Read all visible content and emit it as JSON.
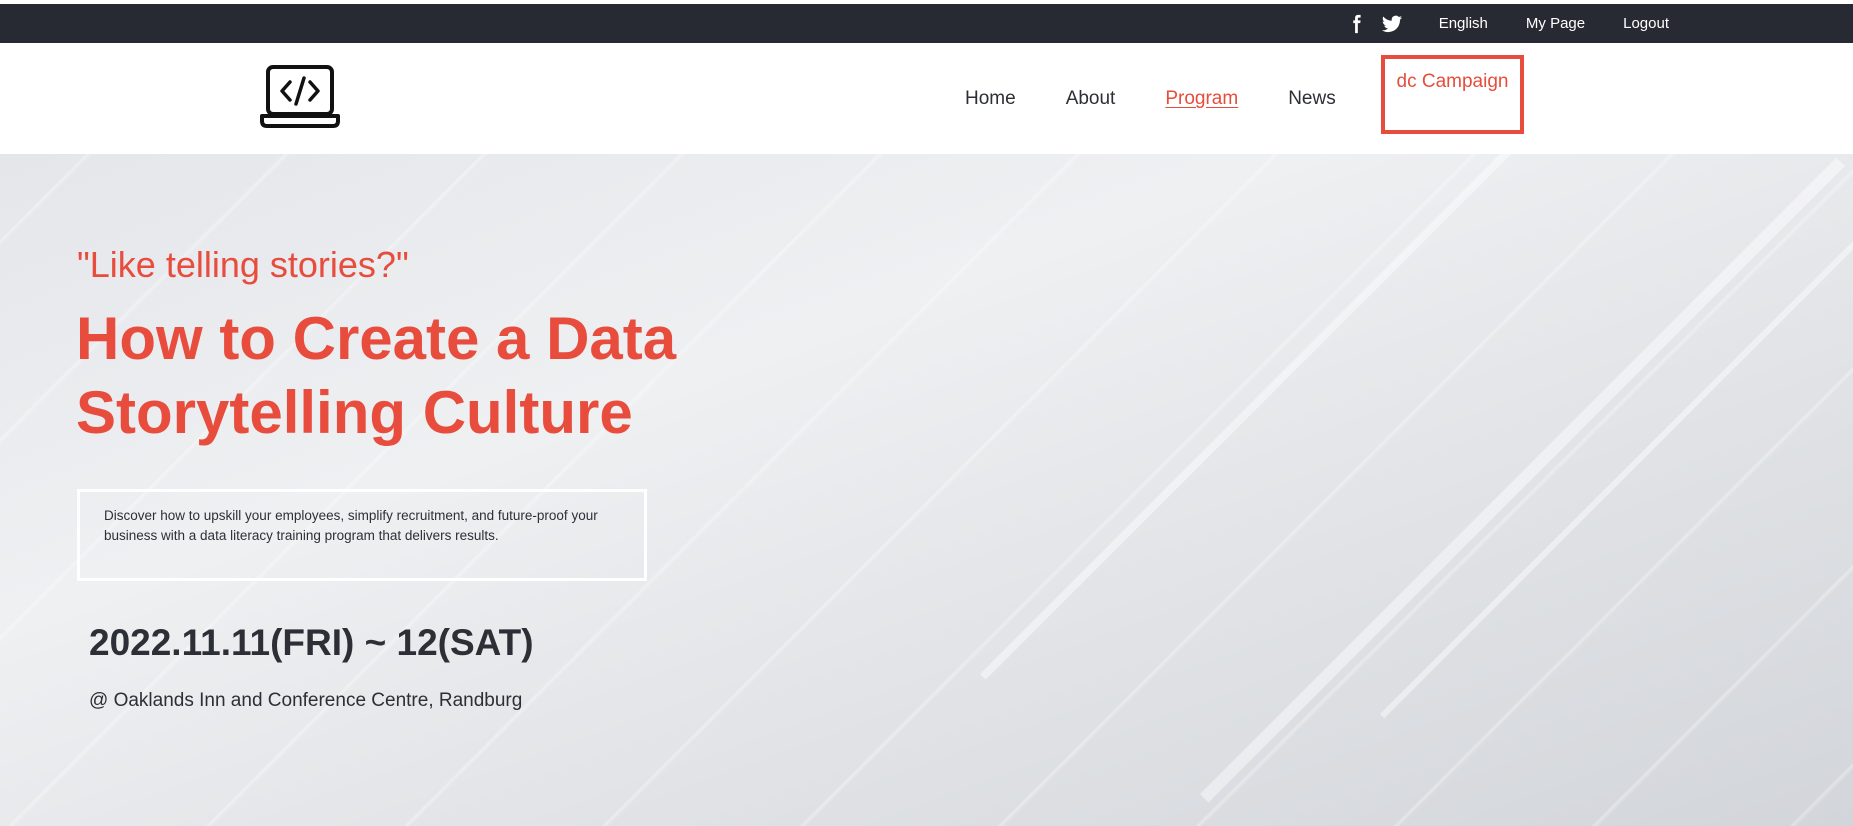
{
  "topbar": {
    "social": [
      "facebook-icon",
      "twitter-icon"
    ],
    "language": "English",
    "my_page": "My Page",
    "logout": "Logout"
  },
  "navbar": {
    "logo_icon": "laptop-code-icon",
    "items": [
      {
        "label": "Home",
        "active": false
      },
      {
        "label": "About",
        "active": false
      },
      {
        "label": "Program",
        "active": true
      },
      {
        "label": "News",
        "active": false
      }
    ],
    "campaign": "dc Campaign"
  },
  "hero": {
    "kicker": "\"Like telling stories?\"",
    "headline_line1": "How to Create a Data",
    "headline_line2": "Storytelling Culture",
    "description": "Discover how to upskill your employees, simplify recruitment, and future-proof your business with a data literacy training program that delivers results.",
    "date": "2022.11.11(FRI) ~ 12(SAT)",
    "venue": "@ Oaklands Inn and Conference Centre, Randburg"
  },
  "colors": {
    "accent": "#e74c3c",
    "topbar_bg": "#272a32",
    "text_dark": "#2c2f36"
  }
}
